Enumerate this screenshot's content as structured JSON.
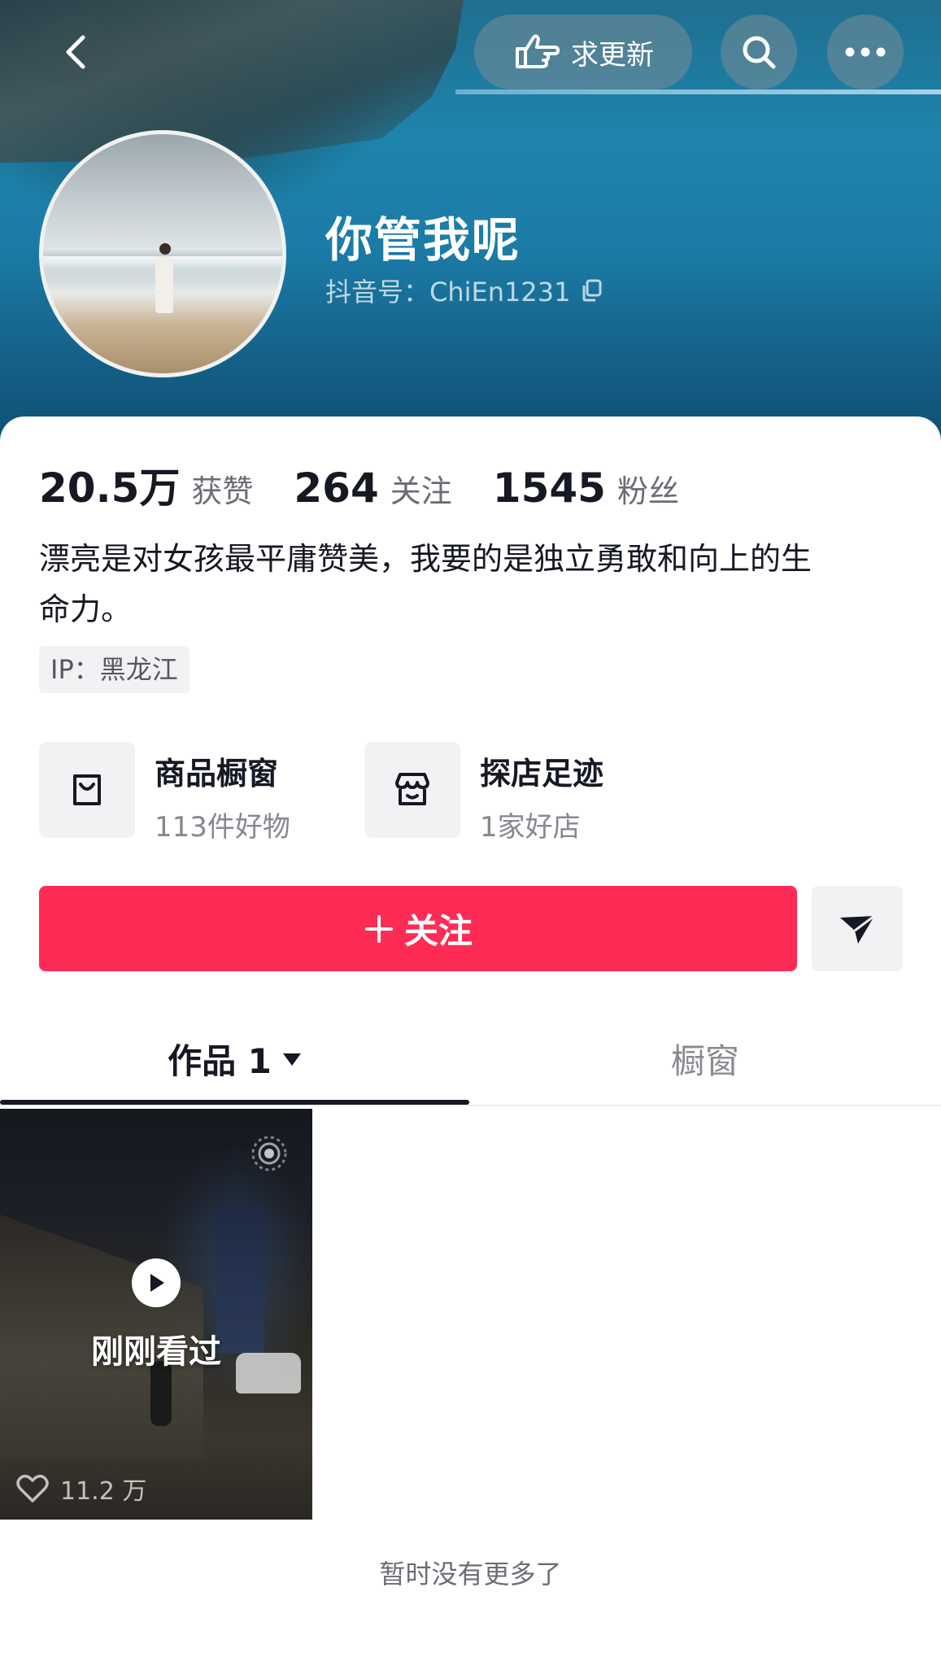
{
  "header": {
    "refresh_label": "求更新"
  },
  "profile": {
    "username": "你管我呢",
    "douyin_id": "抖音号：ChiEn1231"
  },
  "stats": [
    {
      "value": "20.5万",
      "label": "获赞"
    },
    {
      "value": "264",
      "label": "关注"
    },
    {
      "value": "1545",
      "label": "粉丝"
    }
  ],
  "bio": {
    "line1": "漂亮是对女孩最平庸赞美，我要的是独立勇敢和向上的生",
    "line2": "命力。",
    "ip": "IP：黑龙江"
  },
  "features": [
    {
      "title": "商品橱窗",
      "subtitle": "113件好物",
      "icon": "shopping-bag-icon"
    },
    {
      "title": "探店足迹",
      "subtitle": "1家好店",
      "icon": "store-icon"
    }
  ],
  "actions": {
    "follow_label": "关注"
  },
  "tabs": [
    {
      "label": "作品 1",
      "active": true
    },
    {
      "label": "橱窗",
      "active": false
    }
  ],
  "videos": [
    {
      "overlay": "刚刚看过",
      "likes": "11.2 万"
    }
  ],
  "footer": {
    "end_note": "暂时没有更多了"
  },
  "colors": {
    "accent": "#fe2c55",
    "text": "#161823"
  }
}
